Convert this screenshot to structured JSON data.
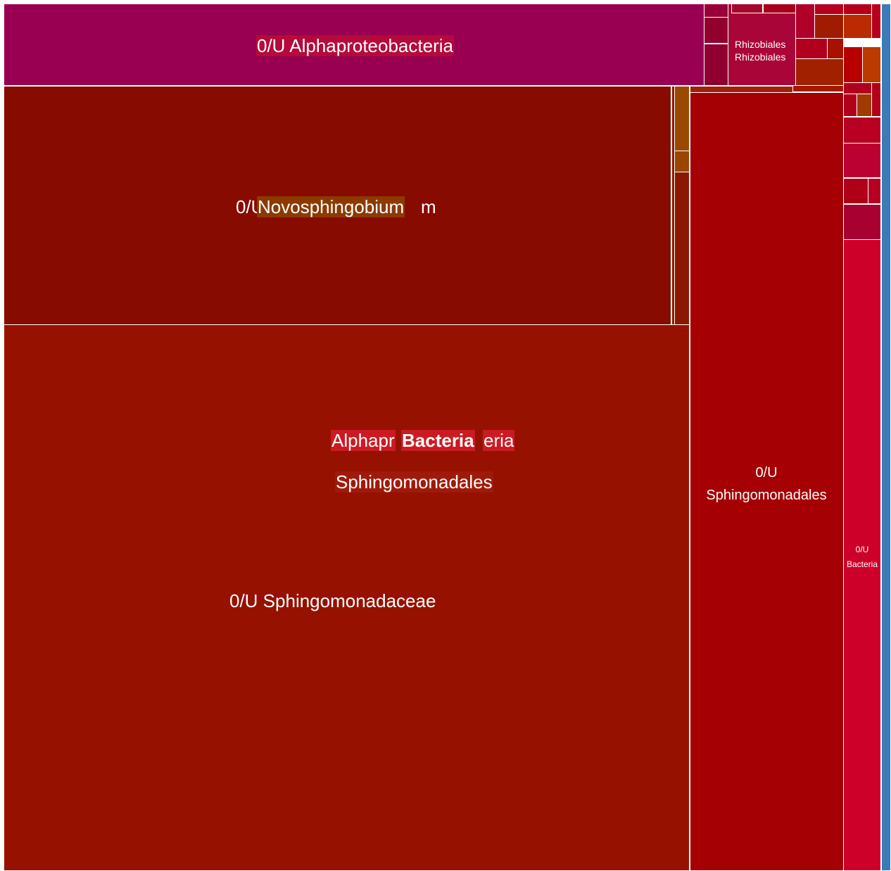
{
  "chart_data": {
    "type": "treemap",
    "title": "",
    "root_label": "Bacteria",
    "tiles": [
      {
        "id": "alphaproteobacteria-unassigned",
        "label": "0/U Alphaproteobacteria",
        "color": "#990052"
      },
      {
        "id": "novosphingobium-unassigned",
        "label_left": "0/U",
        "label_overlay": "Novosphingobium",
        "label_tail": "m",
        "color": "#880b00"
      },
      {
        "id": "sphingomonadaceae-unassigned",
        "label": "0/U Sphingomonadaceae",
        "color": "#961100"
      },
      {
        "id": "sphingomonadales-unassigned",
        "label": "0/U",
        "label2": "Sphingomonadales",
        "color": "#a50004"
      },
      {
        "id": "bacteria-unassigned",
        "label": "0/U",
        "label2": "Bacteria",
        "color": "#cc0029"
      },
      {
        "id": "rhizobiales",
        "label": "Rhizobiales",
        "label2": "Rhizobiales",
        "color": "#aa0538"
      },
      {
        "id": "other-bacteria-strip",
        "label": "",
        "color": "#3a7bb8"
      }
    ],
    "breadcrumb": {
      "line1_left": "Alphapr",
      "line1_bold": "Bacteria",
      "line1_right": "eria",
      "line2": "Sphingomonadales"
    },
    "colors": {
      "highlight_alpha": "#b50a3a",
      "highlight_novo": "#8c3a00",
      "highlight_bacteria": "#cc1a22",
      "highlight_sphingo": "#a01a0a"
    }
  }
}
